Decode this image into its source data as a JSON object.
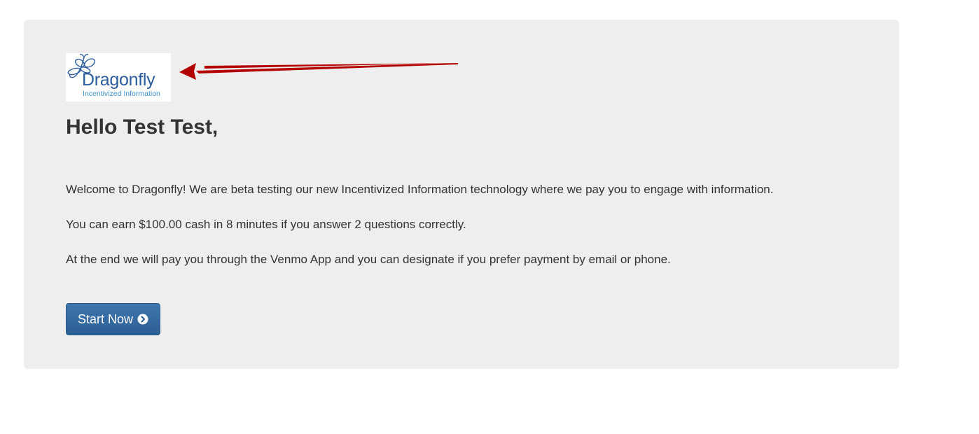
{
  "logo": {
    "brand": "Dragonfly",
    "tagline": "Incentivized Information",
    "icon": "dragonfly-icon"
  },
  "greeting": "Hello Test Test,",
  "paragraphs": {
    "intro": "Welcome to Dragonfly! We are beta testing our new Incentivized Information technology where we pay you to engage with information.",
    "earn": "You can earn $100.00 cash in 8 minutes if you answer 2 questions correctly.",
    "payment": "At the end we will pay you through the Venmo App and you can designate if you prefer payment by email or phone."
  },
  "start_button": {
    "label": "Start Now",
    "icon": "chevron-circle-right-icon"
  },
  "annotation": {
    "arrow_icon": "arrow-left-icon",
    "arrow_color": "#b30000"
  },
  "colors": {
    "panel_bg": "#eeeeee",
    "button_bg": "#2c5f94",
    "text": "#333333",
    "logo_blue": "#2b5d9c"
  }
}
